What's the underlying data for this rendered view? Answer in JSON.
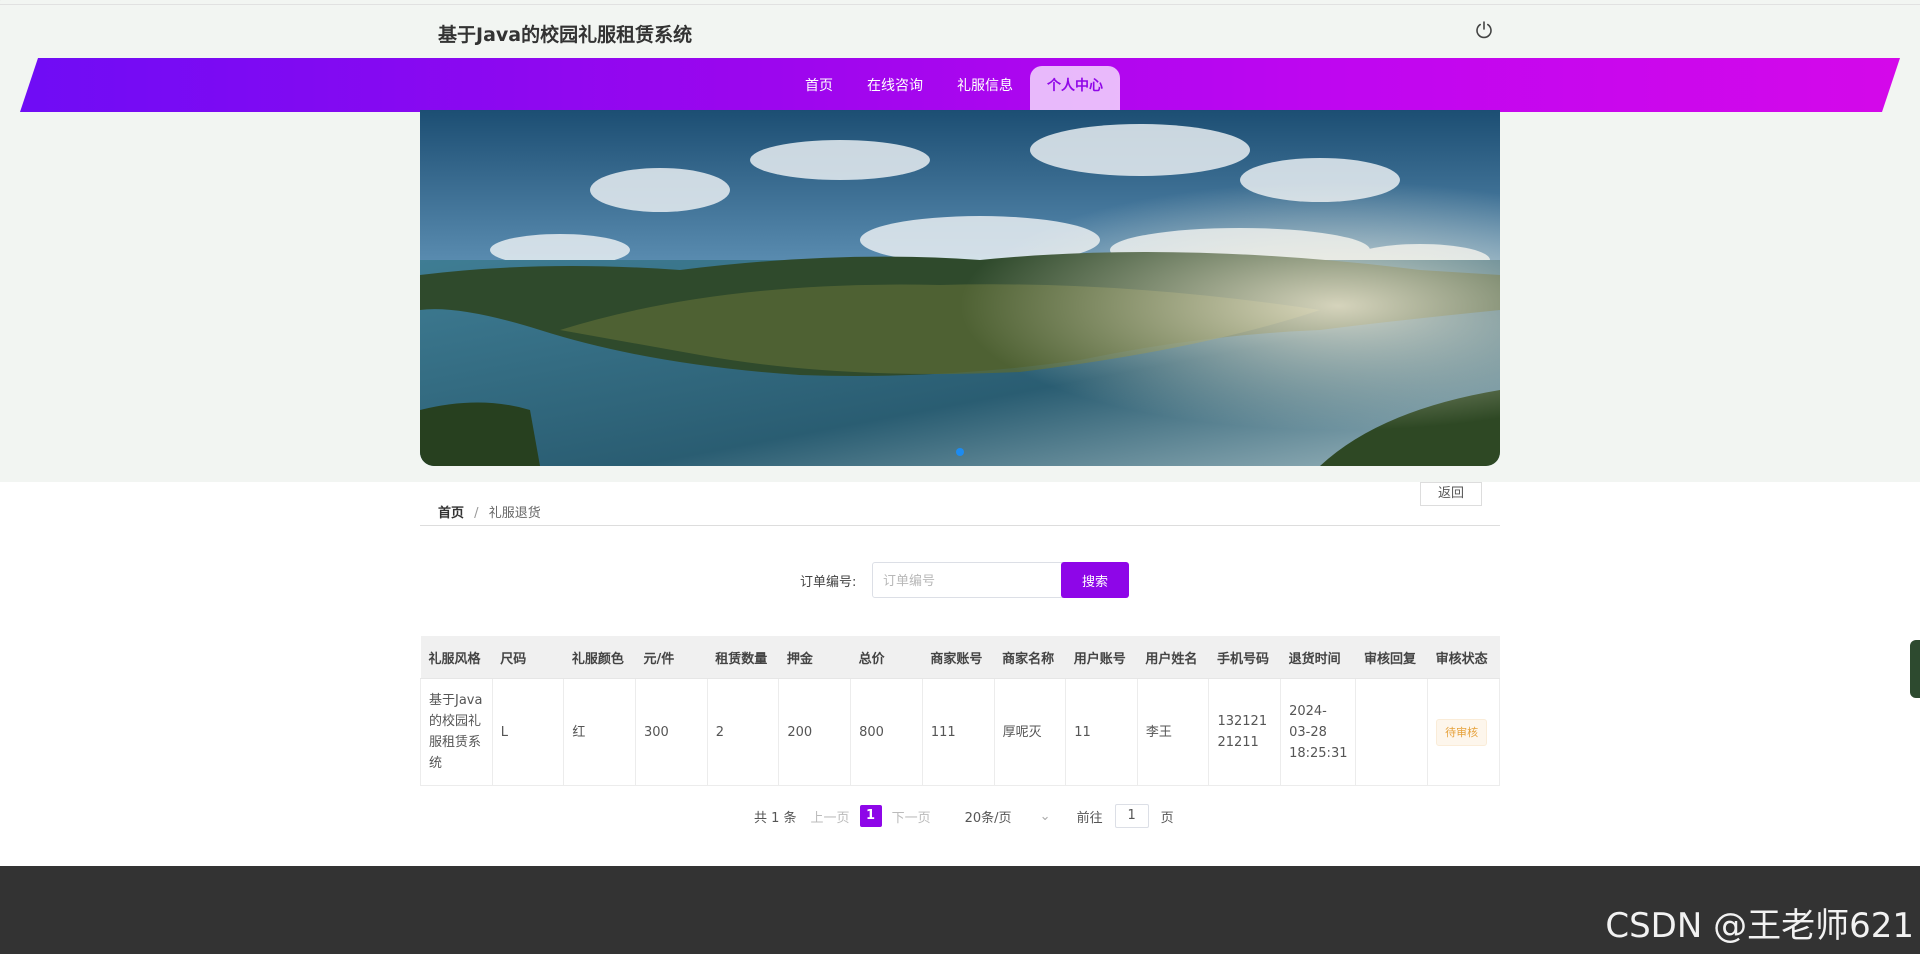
{
  "header": {
    "title": "基于Java的校园礼服租赁系统",
    "power_icon": "power-icon"
  },
  "nav": {
    "items": [
      {
        "label": "首页"
      },
      {
        "label": "在线咨询"
      },
      {
        "label": "礼服信息"
      },
      {
        "label": "个人中心"
      }
    ],
    "active_index": 3
  },
  "banner": {
    "carousel_dots": 1
  },
  "breadcrumb": {
    "home": "首页",
    "separator": "/",
    "current": "礼服退货",
    "back_label": "返回"
  },
  "search": {
    "label": "订单编号:",
    "placeholder": "订单编号",
    "button_label": "搜索"
  },
  "table": {
    "columns": [
      "礼服风格",
      "尺码",
      "礼服颜色",
      "元/件",
      "租赁数量",
      "押金",
      "总价",
      "商家账号",
      "商家名称",
      "用户账号",
      "用户姓名",
      "手机号码",
      "退货时间",
      "审核回复",
      "审核状态"
    ],
    "rows": [
      {
        "style": "基于Java的校园礼服租赁系统",
        "size": "L",
        "color": "红",
        "price": "300",
        "quantity": "2",
        "deposit": "200",
        "total": "800",
        "merchant_account": "111",
        "merchant_name": "厚呢灭",
        "user_account": "11",
        "user_name": "李王",
        "phone": "13212121211",
        "return_time": "2024-03-28 18:25:31",
        "review_reply": "",
        "review_status": "待审核"
      }
    ]
  },
  "pagination": {
    "total_text": "共 1 条",
    "prev_label": "上一页",
    "current_page": "1",
    "next_label": "下一页",
    "page_size": "20条/页",
    "goto_label": "前往",
    "goto_value": "1",
    "page_suffix": "页"
  },
  "watermark": "CSDN @王老师621",
  "colors": {
    "brand_purple": "#8e06e8",
    "nav_gradient_start": "#6f0cf5",
    "nav_gradient_end": "#d408ea",
    "footer": "#333333",
    "status_tag": "#e6a23c"
  }
}
